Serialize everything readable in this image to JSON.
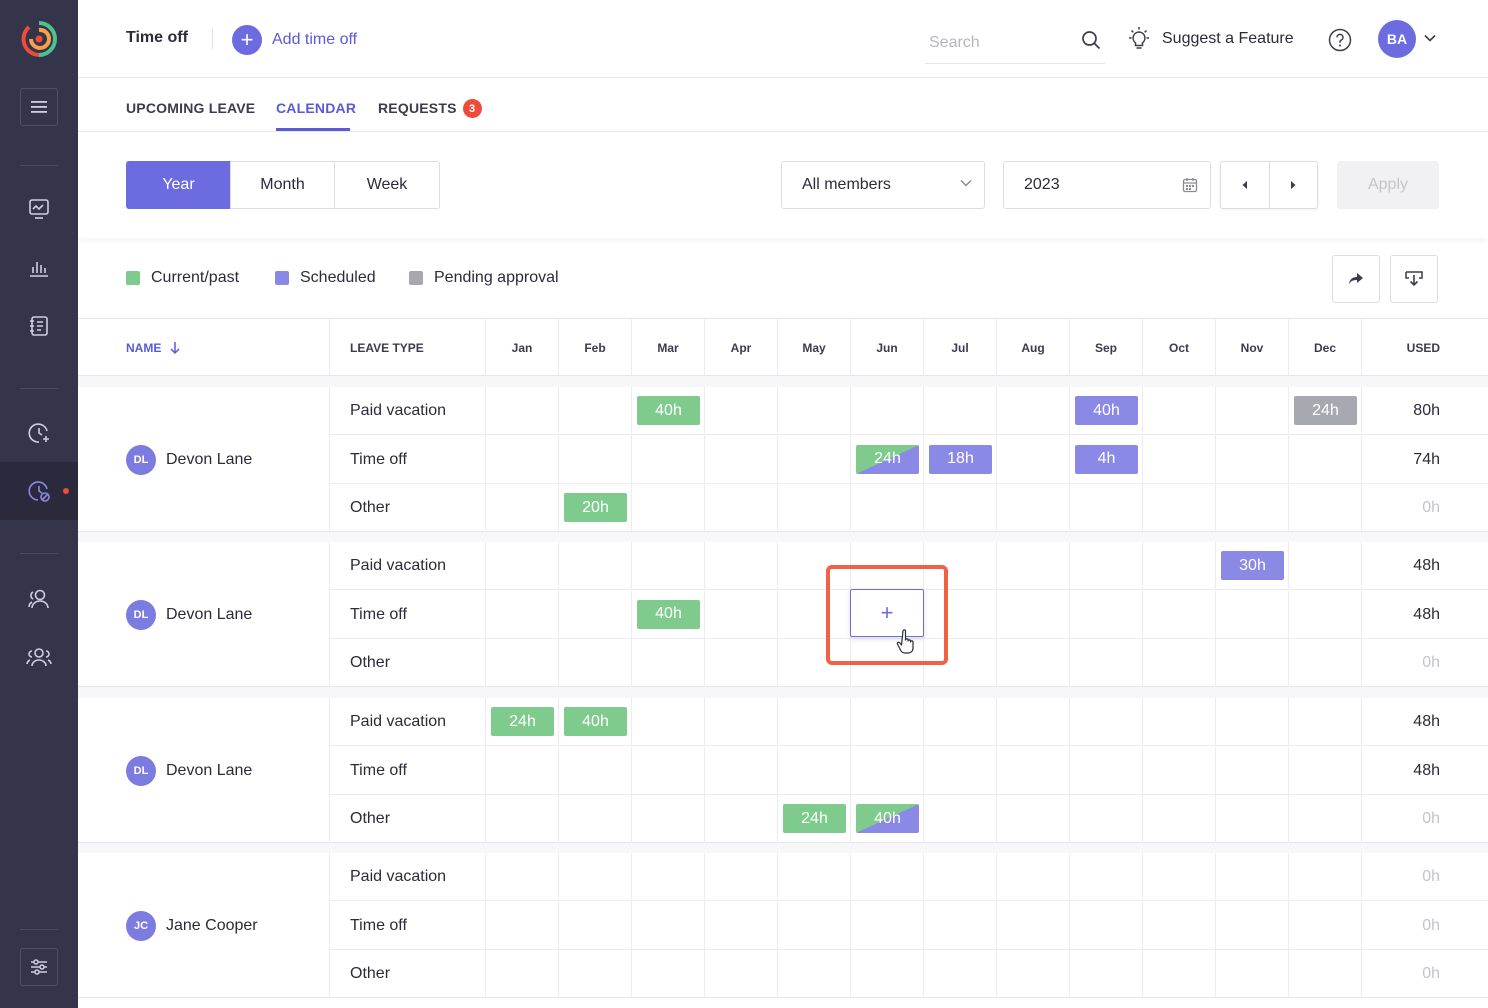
{
  "app": {
    "title": "Time off",
    "add_label": "Add time off",
    "search_placeholder": "Search",
    "suggest_label": "Suggest a Feature",
    "user_initials": "BA"
  },
  "tabs": [
    {
      "label": "UPCOMING LEAVE"
    },
    {
      "label": "CALENDAR",
      "active": true
    },
    {
      "label": "REQUESTS",
      "badge": "3"
    }
  ],
  "filters": {
    "views": [
      "Year",
      "Month",
      "Week"
    ],
    "active_view": "Year",
    "members": "All members",
    "year": "2023",
    "apply_label": "Apply"
  },
  "legend": [
    {
      "label": "Current/past",
      "color": "#7fcb8e"
    },
    {
      "label": "Scheduled",
      "color": "#8a8ae6"
    },
    {
      "label": "Pending approval",
      "color": "#a8a8b0"
    }
  ],
  "table": {
    "headers": {
      "name": "NAME",
      "leave_type": "LEAVE TYPE",
      "months": [
        "Jan",
        "Feb",
        "Mar",
        "Apr",
        "May",
        "Jun",
        "Jul",
        "Aug",
        "Sep",
        "Oct",
        "Nov",
        "Dec"
      ],
      "used": "USED"
    },
    "groups": [
      {
        "initials": "DL",
        "name": "Devon Lane",
        "rows": [
          {
            "type": "Paid vacation",
            "used": "80h",
            "chips": [
              {
                "month": 2,
                "label": "40h",
                "status": "green"
              },
              {
                "month": 8,
                "label": "40h",
                "status": "blue"
              },
              {
                "month": 11,
                "label": "24h",
                "status": "grey"
              }
            ]
          },
          {
            "type": "Time off",
            "used": "74h",
            "chips": [
              {
                "month": 5,
                "label": "24h",
                "status": "mix"
              },
              {
                "month": 6,
                "label": "18h",
                "status": "blue"
              },
              {
                "month": 8,
                "label": "4h",
                "status": "blue"
              }
            ]
          },
          {
            "type": "Other",
            "used": "0h",
            "chips": [
              {
                "month": 1,
                "label": "20h",
                "status": "green"
              }
            ]
          }
        ]
      },
      {
        "initials": "DL",
        "name": "Devon Lane",
        "rows": [
          {
            "type": "Paid vacation",
            "used": "48h",
            "chips": [
              {
                "month": 10,
                "label": "30h",
                "status": "blue"
              }
            ]
          },
          {
            "type": "Time off",
            "used": "48h",
            "chips": [
              {
                "month": 2,
                "label": "40h",
                "status": "green"
              }
            ]
          },
          {
            "type": "Other",
            "used": "0h",
            "chips": []
          }
        ]
      },
      {
        "initials": "DL",
        "name": "Devon Lane",
        "rows": [
          {
            "type": "Paid vacation",
            "used": "48h",
            "chips": [
              {
                "month": 0,
                "label": "24h",
                "status": "green"
              },
              {
                "month": 1,
                "label": "40h",
                "status": "green"
              }
            ]
          },
          {
            "type": "Time off",
            "used": "48h",
            "chips": []
          },
          {
            "type": "Other",
            "used": "0h",
            "chips": [
              {
                "month": 4,
                "label": "24h",
                "status": "green"
              },
              {
                "month": 5,
                "label": "40h",
                "status": "mix"
              }
            ]
          }
        ]
      },
      {
        "initials": "JC",
        "name": "Jane Cooper",
        "rows": [
          {
            "type": "Paid vacation",
            "used": "0h",
            "chips": []
          },
          {
            "type": "Time off",
            "used": "0h",
            "chips": []
          },
          {
            "type": "Other",
            "used": "0h",
            "chips": []
          }
        ]
      }
    ]
  },
  "add_cell_symbol": "+"
}
